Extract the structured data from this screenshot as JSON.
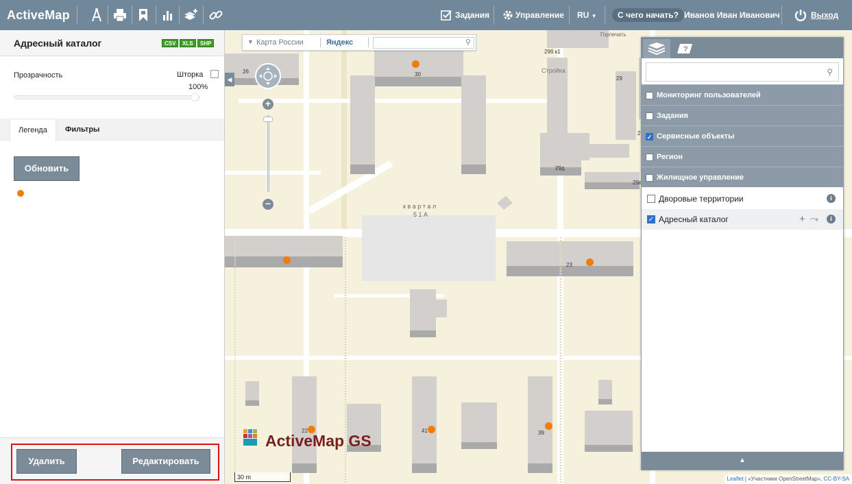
{
  "topbar": {
    "logo": "ActiveMap",
    "tasks_label": "Задания",
    "management_label": "Управление",
    "lang_label": "RU",
    "get_started_label": "С чего начать?",
    "user_name": "Иванов Иван Иванович",
    "logout_label": "Выход",
    "tool_icons": [
      "measure-icon",
      "print-icon",
      "bookmark-icon",
      "chart-icon",
      "add-layer-icon",
      "link-icon"
    ]
  },
  "left_panel": {
    "title": "Адресный каталог",
    "export_formats": [
      "CSV",
      "XLS",
      "SHP"
    ],
    "opacity_label": "Прозрачность",
    "curtain_label": "Шторка",
    "curtain_checked": false,
    "opacity_value": "100%",
    "opacity_fraction": 1.0,
    "tabs": [
      {
        "label": "Легенда",
        "active": true
      },
      {
        "label": "Фильтры",
        "active": false
      }
    ],
    "refresh_label": "Обновить",
    "legend_color": "#f07d0a",
    "footer": {
      "delete_label": "Удалить",
      "edit_label": "Редактировать"
    }
  },
  "map": {
    "source": {
      "base_label": "Карта России",
      "provider_label": "Яндекс",
      "search_value": ""
    },
    "labels": {
      "b296x1": "29б к1",
      "stroika": "Стройка",
      "n29": "29",
      "n30": "30",
      "n29b": "29б",
      "n29d": "29д",
      "n29v": "29в",
      "n26": "26",
      "kvartal": "к в а р т а л",
      "kvartal_num": "5 1 А",
      "n23": "23",
      "n22": "22",
      "n41": "41",
      "n39": "39",
      "gorpechat": "Горпечать"
    },
    "watermark": "ActiveMap GS",
    "scale_label": "30 m",
    "attribution": {
      "leaflet": "Leaflet",
      "osm": "«Участники OpenStreetMap»,",
      "cc": "CC-BY-SA"
    },
    "poi_color": "#f07d0a"
  },
  "layers_panel": {
    "search_placeholder": "",
    "groups": [
      {
        "label": "Мониторинг пользователей",
        "checked": false
      },
      {
        "label": "Задания",
        "checked": false
      },
      {
        "label": "Сервисные объекты",
        "checked": true
      },
      {
        "label": "Регион",
        "checked": false
      },
      {
        "label": "Жилищное управление",
        "checked": false
      }
    ],
    "layers": [
      {
        "label": "Дворовые территории",
        "checked": false
      },
      {
        "label": "Адресный каталог",
        "checked": true
      }
    ]
  },
  "colors": {
    "topbar_bg": "#71879a",
    "button_bg": "#7b8b98",
    "highlight_border": "#dd1111",
    "checkbox_on": "#2f71c7"
  }
}
